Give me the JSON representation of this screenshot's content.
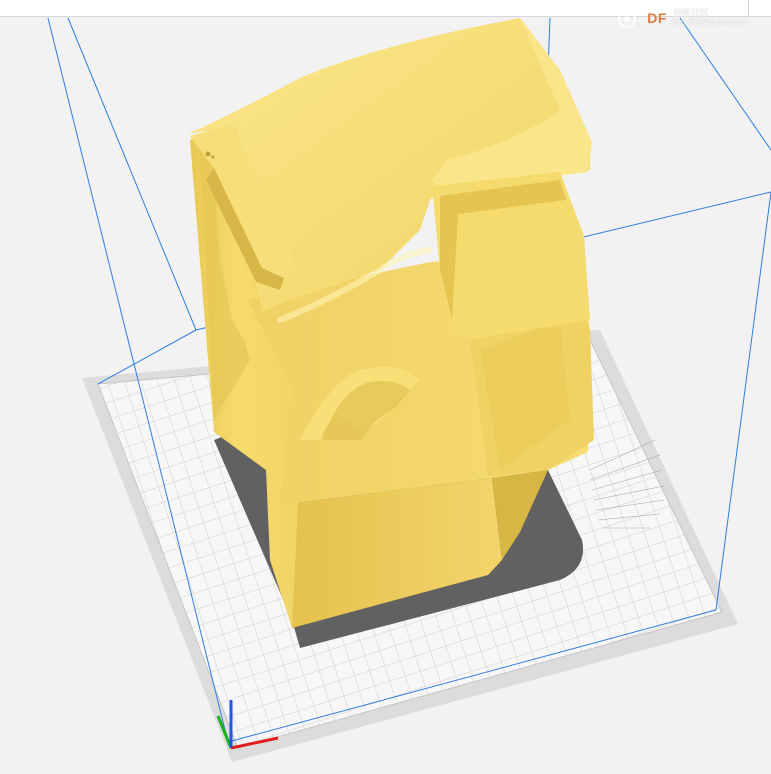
{
  "app": {
    "view": "3d-viewport",
    "watermark": {
      "brand": "DF",
      "line1": "创客社区",
      "line2": "mc.dfrobot.com.cn"
    }
  },
  "colors": {
    "model": "#f3d56b",
    "model_shadow": "#d9b94c",
    "build_volume_lines": "#2f7de0",
    "plate": "#e2e2e2",
    "grid": "#c9c9c9",
    "model_footprint": "#606060",
    "axis_x": "#e11d1d",
    "axis_y": "#1bb11b",
    "axis_z": "#1f57e6"
  },
  "icons": {
    "watermark_logo": "dfrobot-logo-icon"
  }
}
